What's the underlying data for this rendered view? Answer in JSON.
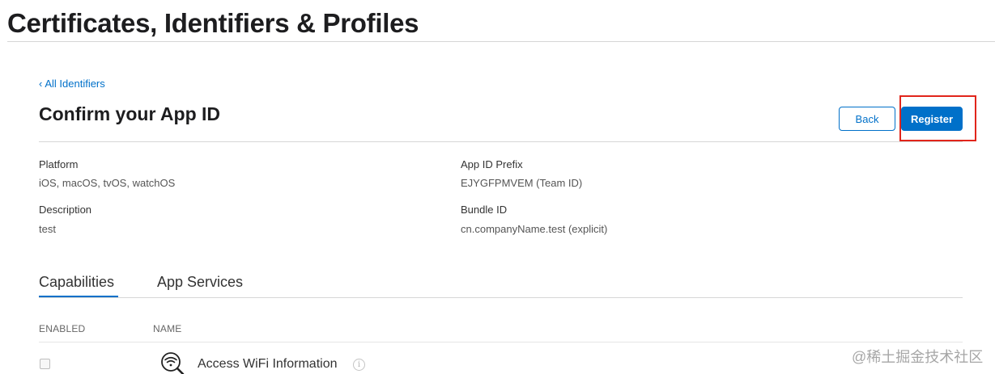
{
  "app": {
    "title": "Certificates, Identifiers & Profiles"
  },
  "nav": {
    "back_link_chevron": "‹",
    "back_link_label": "All Identifiers"
  },
  "page": {
    "heading": "Confirm your App ID"
  },
  "actions": {
    "back_label": "Back",
    "register_label": "Register"
  },
  "details": {
    "platform": {
      "label": "Platform",
      "value": "iOS, macOS, tvOS, watchOS"
    },
    "app_id_prefix": {
      "label": "App ID Prefix",
      "value": "EJYGFPMVEM (Team ID)"
    },
    "description": {
      "label": "Description",
      "value": "test"
    },
    "bundle_id": {
      "label": "Bundle ID",
      "value": "cn.companyName.test (explicit)"
    }
  },
  "tabs": [
    {
      "label": "Capabilities",
      "active": true
    },
    {
      "label": "App Services",
      "active": false
    }
  ],
  "table": {
    "columns": [
      "ENABLED",
      "NAME"
    ],
    "rows": [
      {
        "enabled": false,
        "name": "Access WiFi Information",
        "icon": "wifi-search-icon",
        "info_glyph": "i"
      }
    ]
  },
  "watermark": {
    "text": "@稀土掘金技术社区"
  },
  "colors": {
    "accent": "#0070c9",
    "highlight": "#e1251b",
    "text": "#1d1d1f"
  }
}
